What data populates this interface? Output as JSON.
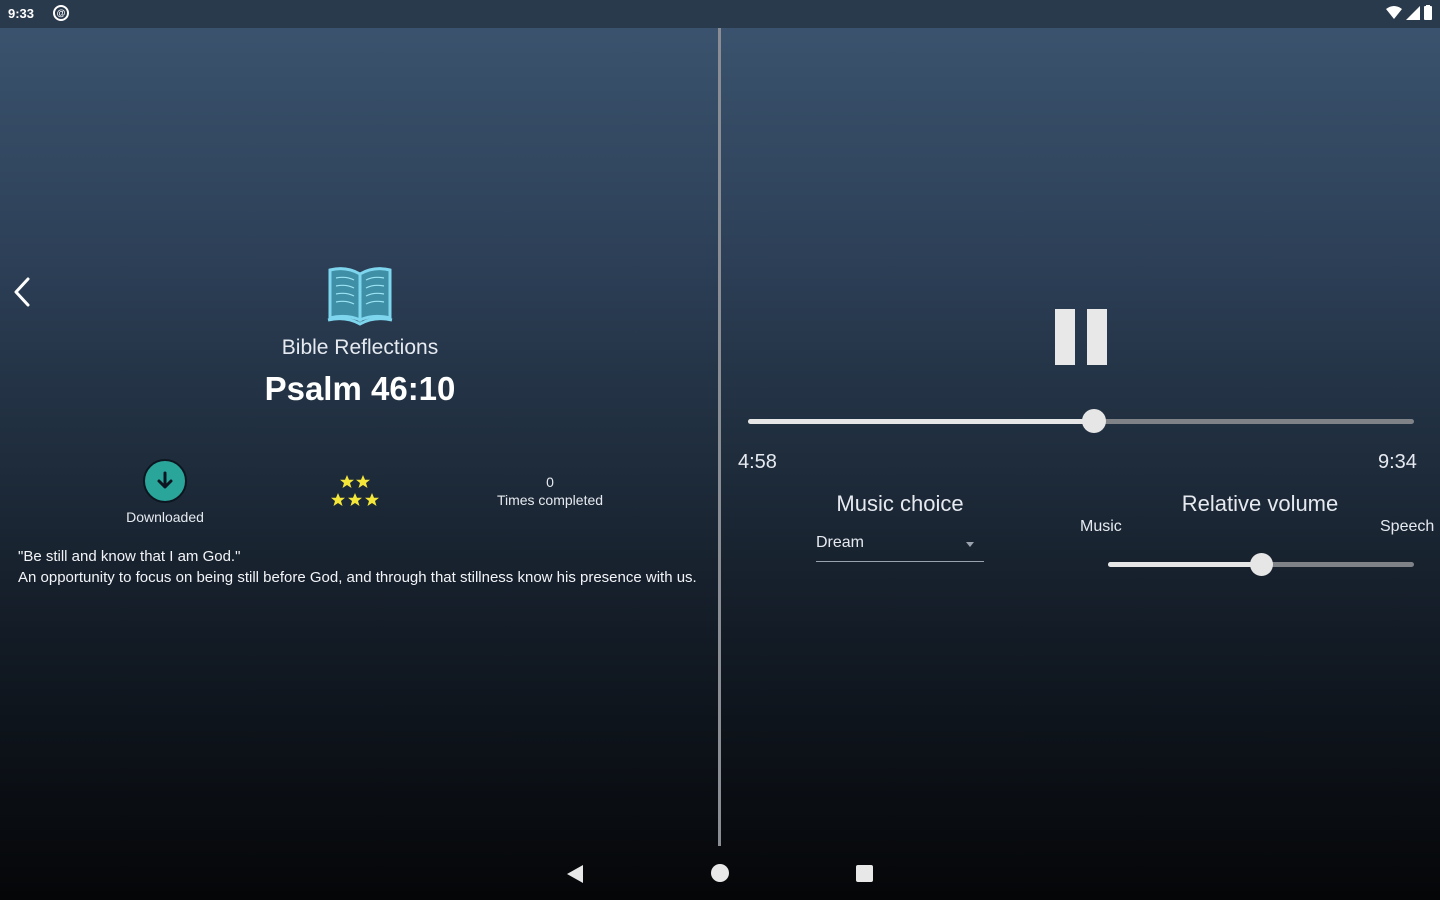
{
  "status_bar": {
    "time": "9:33",
    "notification_badge": "@"
  },
  "session": {
    "category": "Bible Reflections",
    "title": "Psalm 46:10",
    "downloaded_label": "Downloaded",
    "rating_stars": 5,
    "times_completed_count": "0",
    "times_completed_label": "Times completed",
    "quote_line1": "\"Be still and know that I am God.\"",
    "quote_line2": "An opportunity to focus on being still before God, and through that stillness know his presence with us."
  },
  "player": {
    "elapsed": "4:58",
    "total": "9:34",
    "progress_fraction": 0.52,
    "music_choice_label": "Music choice",
    "music_choice_value": "Dream",
    "relative_volume_label": "Relative volume",
    "music_label": "Music",
    "speech_label": "Speech",
    "relative_volume_fraction": 0.5
  },
  "colors": {
    "accent_teal": "#2aa59a",
    "book_icon": "#7ed6ee",
    "star": "#f5e63a"
  },
  "icons": {
    "back": "chevron-left-icon",
    "book": "open-book-icon",
    "download": "download-arrow-icon",
    "pause": "pause-icon"
  }
}
